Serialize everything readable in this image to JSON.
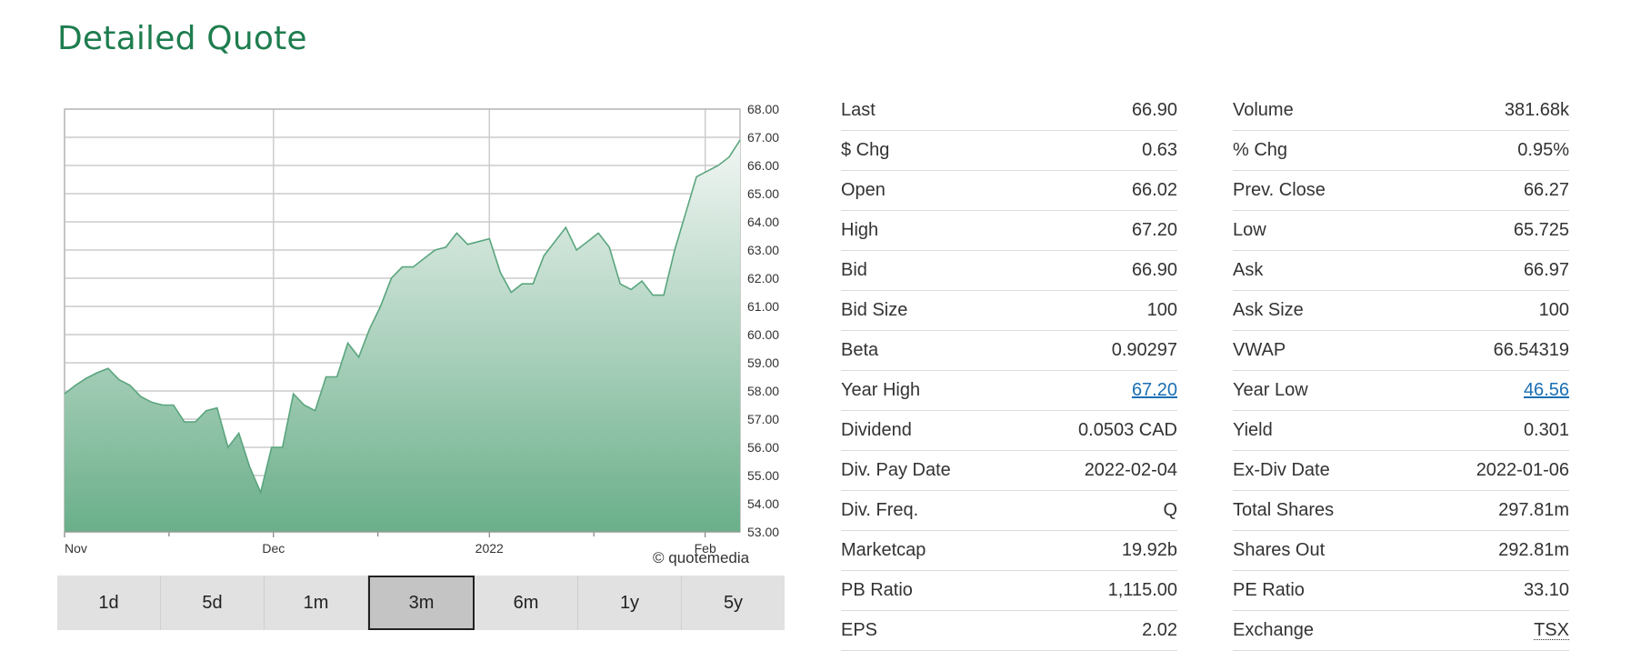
{
  "page": {
    "title": "Detailed Quote"
  },
  "chart_data": {
    "type": "area",
    "x_labels": [
      {
        "label": "Nov",
        "day": 0
      },
      {
        "label": "Dec",
        "day": 30
      },
      {
        "label": "2022",
        "day": 61
      },
      {
        "label": "Feb",
        "day": 92
      }
    ],
    "ylim": [
      53.0,
      68.0
    ],
    "yticks": [
      "68.00",
      "67.00",
      "66.00",
      "65.00",
      "64.00",
      "63.00",
      "62.00",
      "61.00",
      "60.00",
      "59.00",
      "58.00",
      "57.00",
      "56.00",
      "55.00",
      "54.00",
      "53.00"
    ],
    "xlim": [
      0,
      97
    ],
    "series": [
      {
        "points": [
          [
            0,
            57.9
          ],
          [
            1,
            58.2
          ],
          [
            2,
            58.45
          ],
          [
            3,
            58.65
          ],
          [
            4,
            58.8
          ],
          [
            5,
            58.4
          ],
          [
            6,
            58.2
          ],
          [
            7,
            57.8
          ],
          [
            8,
            57.6
          ],
          [
            9,
            57.5
          ],
          [
            10,
            57.5
          ],
          [
            11,
            56.9
          ],
          [
            12,
            56.9
          ],
          [
            13,
            57.3
          ],
          [
            14,
            57.4
          ],
          [
            15,
            56.0
          ],
          [
            16,
            56.5
          ],
          [
            17,
            55.3
          ],
          [
            18,
            54.4
          ],
          [
            19,
            56.0
          ],
          [
            20,
            56.0
          ],
          [
            21,
            57.9
          ],
          [
            22,
            57.5
          ],
          [
            23,
            57.3
          ],
          [
            24,
            58.5
          ],
          [
            25,
            58.5
          ],
          [
            26,
            59.7
          ],
          [
            27,
            59.2
          ],
          [
            28,
            60.2
          ],
          [
            29,
            61.0
          ],
          [
            30,
            62.0
          ],
          [
            31,
            62.4
          ],
          [
            32,
            62.4
          ],
          [
            33,
            62.7
          ],
          [
            34,
            63.0
          ],
          [
            35,
            63.1
          ],
          [
            36,
            63.6
          ],
          [
            37,
            63.2
          ],
          [
            38,
            63.3
          ],
          [
            39,
            63.4
          ],
          [
            40,
            62.2
          ],
          [
            41,
            61.5
          ],
          [
            42,
            61.8
          ],
          [
            43,
            61.8
          ],
          [
            44,
            62.8
          ],
          [
            45,
            63.3
          ],
          [
            46,
            63.8
          ],
          [
            47,
            63.0
          ],
          [
            48,
            63.3
          ],
          [
            49,
            63.6
          ],
          [
            50,
            63.1
          ],
          [
            51,
            61.8
          ],
          [
            52,
            61.6
          ],
          [
            53,
            61.9
          ],
          [
            54,
            61.4
          ],
          [
            55,
            61.4
          ],
          [
            56,
            63.0
          ],
          [
            57,
            64.3
          ],
          [
            58,
            65.6
          ],
          [
            59,
            65.8
          ],
          [
            60,
            66.0
          ],
          [
            61,
            66.3
          ],
          [
            62,
            66.9
          ]
        ]
      }
    ],
    "credit": "© quotemedia"
  },
  "ranges": [
    {
      "label": "1d",
      "active": false
    },
    {
      "label": "5d",
      "active": false
    },
    {
      "label": "1m",
      "active": false
    },
    {
      "label": "3m",
      "active": true
    },
    {
      "label": "6m",
      "active": false
    },
    {
      "label": "1y",
      "active": false
    },
    {
      "label": "5y",
      "active": false
    }
  ],
  "left_table": [
    {
      "label": "Last",
      "value": "66.90"
    },
    {
      "label": "$ Chg",
      "value": "0.63"
    },
    {
      "label": "Open",
      "value": "66.02"
    },
    {
      "label": "High",
      "value": "67.20"
    },
    {
      "label": "Bid",
      "value": "66.90"
    },
    {
      "label": "Bid Size",
      "value": "100"
    },
    {
      "label": "Beta",
      "value": "0.90297"
    },
    {
      "label": "Year High",
      "value": "67.20",
      "link": true
    },
    {
      "label": "Dividend",
      "value": "0.0503 CAD"
    },
    {
      "label": "Div. Pay Date",
      "value": "2022-02-04"
    },
    {
      "label": "Div. Freq.",
      "value": "Q"
    },
    {
      "label": "Marketcap",
      "value": "19.92b"
    },
    {
      "label": "PB Ratio",
      "value": "1,115.00"
    },
    {
      "label": "EPS",
      "value": "2.02"
    }
  ],
  "right_table": [
    {
      "label": "Volume",
      "value": "381.68k"
    },
    {
      "label": "% Chg",
      "value": "0.95%"
    },
    {
      "label": "Prev. Close",
      "value": "66.27"
    },
    {
      "label": "Low",
      "value": "65.725"
    },
    {
      "label": "Ask",
      "value": "66.97"
    },
    {
      "label": "Ask Size",
      "value": "100"
    },
    {
      "label": "VWAP",
      "value": "66.54319"
    },
    {
      "label": "Year Low",
      "value": "46.56",
      "link": true
    },
    {
      "label": "Yield",
      "value": "0.301"
    },
    {
      "label": "Ex-Div Date",
      "value": "2022-01-06"
    },
    {
      "label": "Total Shares",
      "value": "297.81m"
    },
    {
      "label": "Shares Out",
      "value": "292.81m"
    },
    {
      "label": "PE Ratio",
      "value": "33.10"
    },
    {
      "label": "Exchange",
      "value": "TSX",
      "dotted": true
    }
  ],
  "colors": {
    "title": "#1e7d4e",
    "line": "#5aa57e",
    "fill_top": "#f2f6f4",
    "fill_bottom": "#6aaf8a",
    "grid": "#cccccc",
    "link": "#1a6fb5"
  }
}
